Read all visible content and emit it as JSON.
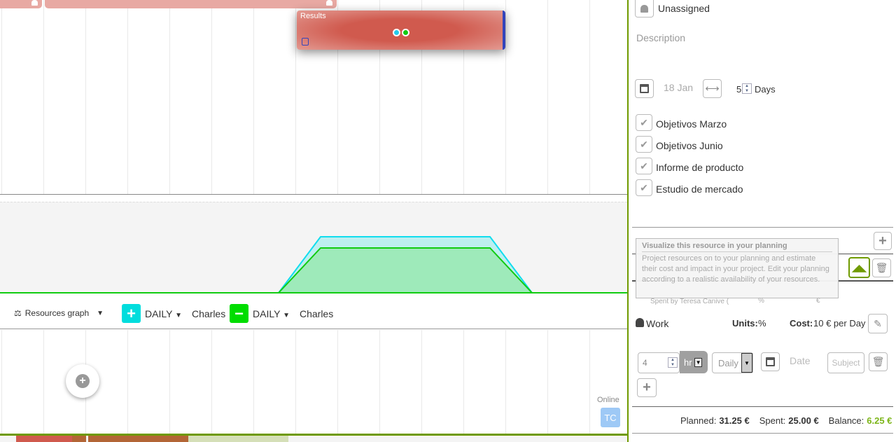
{
  "gantt": {
    "task_card": {
      "title": "Results",
      "color": "#d05a4e",
      "dot_colors": [
        "#22ccee",
        "#11cc11"
      ]
    },
    "resources_toolbar": {
      "graph_label": "Resources graph",
      "series": [
        {
          "sign": "+",
          "period": "DAILY",
          "resource": "Charles",
          "color": "#00dddd"
        },
        {
          "sign": "−",
          "period": "DAILY",
          "resource": "Charles",
          "color": "#00dd00"
        }
      ]
    },
    "online": {
      "label": "Online",
      "avatar_initials": "TC"
    }
  },
  "panel": {
    "assignee": "Unassigned",
    "description_placeholder": "Description",
    "start_date": "18 Jan",
    "duration_value": "5",
    "duration_unit": "Days",
    "checklist": [
      "Objetivos Marzo",
      "Objetivos Junio",
      "Informe de producto",
      "Estudio de mercado"
    ],
    "tooltip": {
      "title": "Visualize this resource in your planning",
      "body": "Project resources on to your planning and estimate their cost and impact in your project. Edit your planning according to a realistic availability of your resources."
    },
    "spent_by": "Spent by Teresa Canive (",
    "percent_symbol": "%",
    "euro_symbol": "€",
    "resource": {
      "type": "Work",
      "units_label": "Units:",
      "units_value": "%",
      "cost_label": "Cost:",
      "cost_value": "10 € per Day"
    },
    "entry": {
      "quantity": "4",
      "unit": "hr",
      "frequency": "Daily",
      "date_placeholder": "Date",
      "subject_placeholder": "Subject"
    },
    "totals": {
      "planned_label": "Planned:",
      "planned": "31.25 €",
      "spent_label": "Spent:",
      "spent": "25.00 €",
      "balance_label": "Balance:",
      "balance": "6.25 €",
      "balance_color": "#7cb518"
    }
  }
}
